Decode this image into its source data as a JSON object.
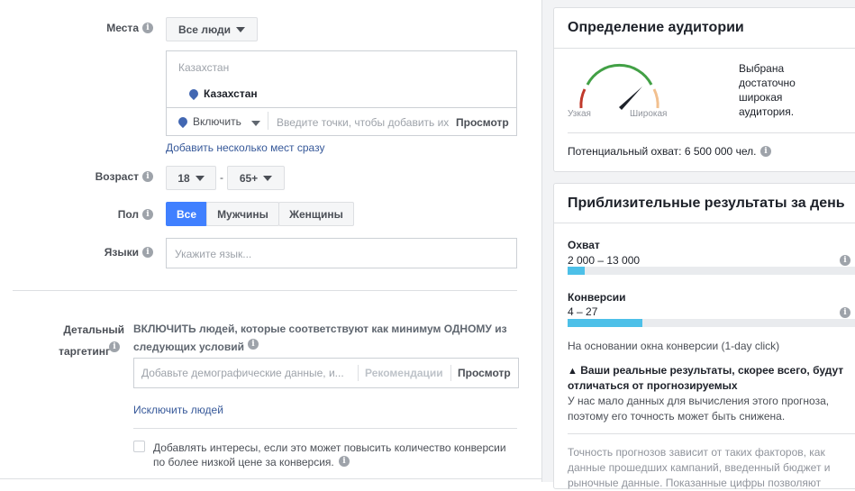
{
  "left": {
    "places": {
      "label": "Места",
      "dropdown": "Все люди",
      "location_header": "Казахстан",
      "selected_location": "Казахстан",
      "include": "Включить",
      "placeholder": "Введите точки, чтобы добавить их",
      "browse": "Просмотр",
      "add_multiple": "Добавить несколько мест сразу"
    },
    "age": {
      "label": "Возраст",
      "min": "18",
      "separator": "-",
      "max": "65+"
    },
    "gender": {
      "label": "Пол",
      "options": [
        "Все",
        "Мужчины",
        "Женщины"
      ],
      "selected": "Все"
    },
    "languages": {
      "label": "Языки",
      "placeholder": "Укажите язык..."
    },
    "detailed": {
      "label_line1": "Детальный",
      "label_line2": "таргетинг",
      "desc_line1": "ВКЛЮЧИТЬ людей, которые соответствуют как минимум ОДНОМУ из",
      "desc_line2": "следующих условий",
      "placeholder": "Добавьте демографические данные, и...",
      "recommendations": "Рекомендации",
      "browse": "Просмотр",
      "exclude": "Исключить людей"
    },
    "expansion": {
      "checked": false,
      "line1": "Добавлять интересы, если это может повысить количество конверсии",
      "line2": "по более низкой цене за конверсия."
    }
  },
  "audience": {
    "title": "Определение аудитории",
    "narrow": "Узкая",
    "broad": "Широкая",
    "status_lines": [
      "Выбрана",
      "достаточно",
      "широкая",
      "аудитория."
    ],
    "potential_reach": "Потенциальный охват: 6 500 000 чел.",
    "colors": {
      "narrow": "#c0392b",
      "good": "#42a045",
      "broad": "#f2c08f"
    }
  },
  "results": {
    "title": "Приблизительные результаты за день",
    "reach": {
      "label": "Охват",
      "value": "2 000 – 13 000",
      "fill_percent": 6
    },
    "conversions": {
      "label": "Конверсии",
      "value": "4 – 27",
      "fill_percent": 26
    },
    "window_note": "На основании окна конверсии (1-day click)",
    "warning_line1": "Ваши реальные результаты, скорее всего, будут",
    "warning_line2": "отличаться от прогнозируемых",
    "warning_text1": "У нас мало данных для вычисления этого прогноза,",
    "warning_text2": "поэтому его точность может быть снижена.",
    "footer1": "Точность прогнозов зависит от таких факторов, как",
    "footer2": "данные прошедших кампаний, введенный бюджет и",
    "footer3": "рыночные данные. Показанные цифры позволяют"
  },
  "accent": "#4080ff"
}
